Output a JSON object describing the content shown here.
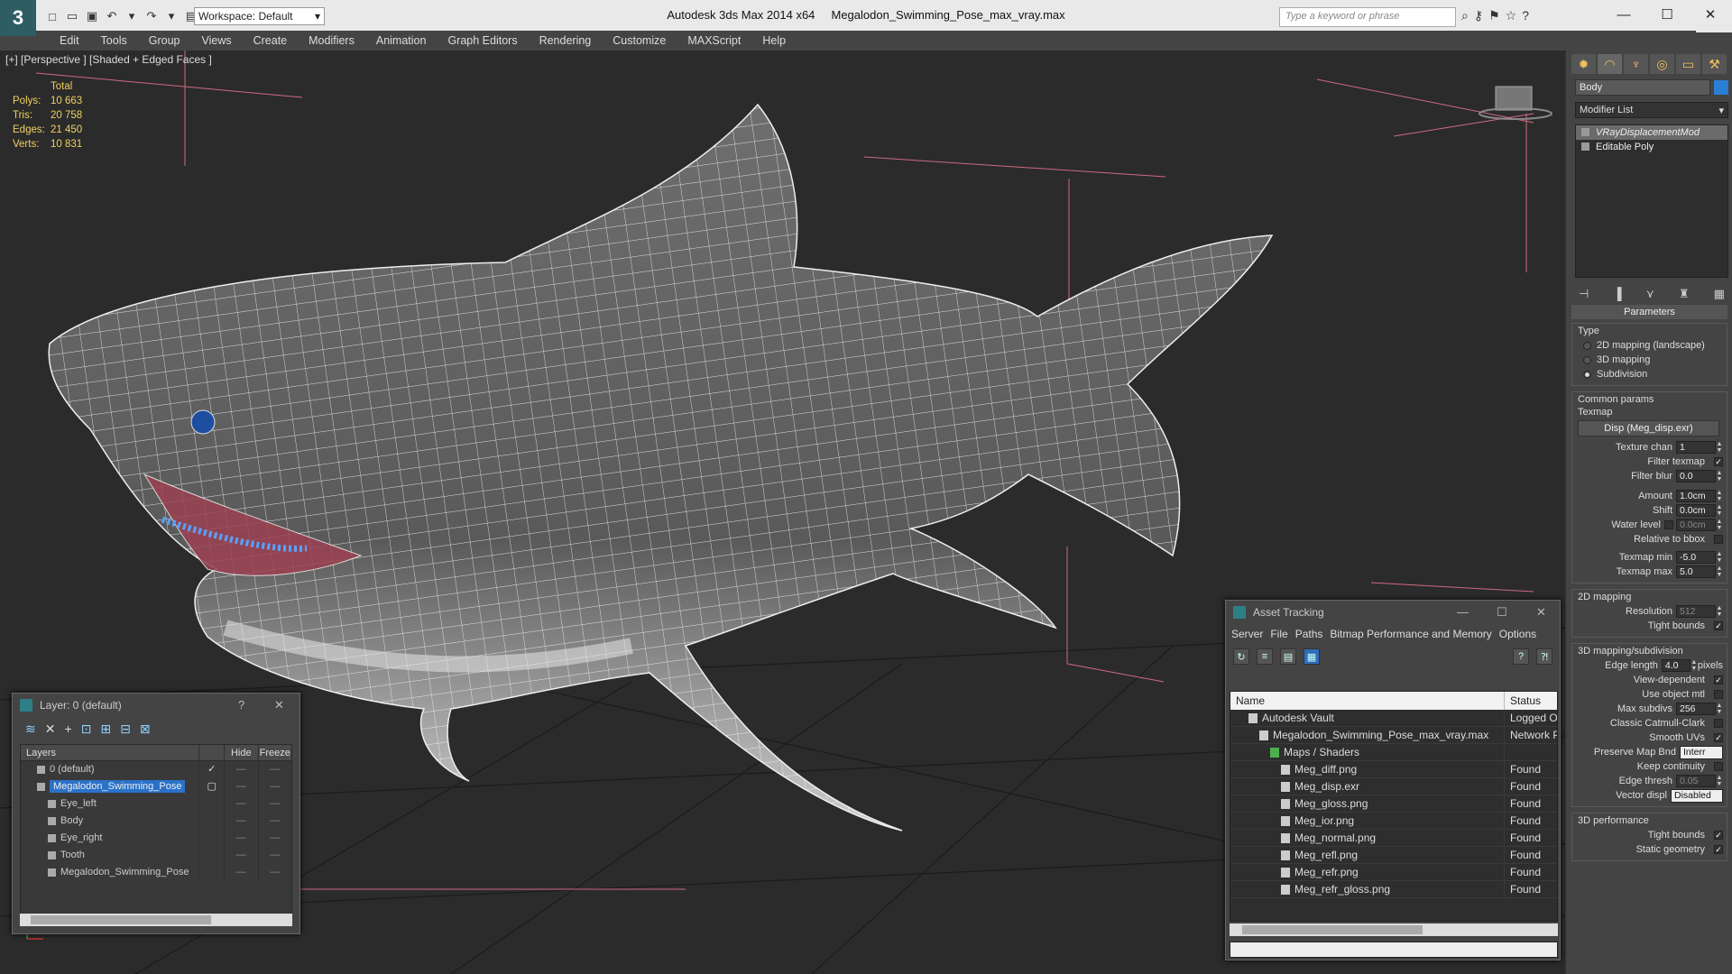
{
  "title_bar": {
    "logo": "3",
    "workspace_label": "Workspace: Default",
    "app_name": "Autodesk 3ds Max  2014 x64",
    "file_name": "Megalodon_Swimming_Pose_max_vray.max",
    "search_placeholder": "Type a keyword or phrase",
    "help_symbol": "?",
    "minimize": "—",
    "maximize": "☐",
    "close": "✕"
  },
  "menu": [
    "Edit",
    "Tools",
    "Group",
    "Views",
    "Create",
    "Modifiers",
    "Animation",
    "Graph Editors",
    "Rendering",
    "Customize",
    "MAXScript",
    "Help"
  ],
  "viewport": {
    "label": "[+] [Perspective ] [Shaded + Edged Faces ]",
    "stats_header": "Total",
    "stats": [
      {
        "label": "Polys:",
        "value": "10 663"
      },
      {
        "label": "Tris:",
        "value": "20 758"
      },
      {
        "label": "Edges:",
        "value": "21 450"
      },
      {
        "label": "Verts:",
        "value": "10 831"
      }
    ]
  },
  "command_panel": {
    "object_name": "Body",
    "object_color": "#2a7fd4",
    "modifier_list": "Modifier List",
    "stack": [
      {
        "label": "VRayDisplacementMod",
        "selected": true
      },
      {
        "label": "Editable Poly",
        "selected": false
      }
    ],
    "rollout_title": "Parameters",
    "type_group": "Type",
    "type_options": [
      {
        "label": "2D mapping (landscape)",
        "on": false
      },
      {
        "label": "3D mapping",
        "on": false
      },
      {
        "label": "Subdivision",
        "on": true
      }
    ],
    "common_group": "Common params",
    "texmap_label": "Texmap",
    "texmap_button": "Disp (Meg_disp.exr)",
    "texture_chan": {
      "label": "Texture chan",
      "value": "1"
    },
    "filter_texmap": {
      "label": "Filter texmap",
      "checked": true
    },
    "filter_blur": {
      "label": "Filter blur",
      "value": "0.0"
    },
    "amount": {
      "label": "Amount",
      "value": "1.0cm"
    },
    "shift": {
      "label": "Shift",
      "value": "0.0cm"
    },
    "water_level": {
      "label": "Water level",
      "value": "0.0cm"
    },
    "relative_to_bbox": {
      "label": "Relative to bbox",
      "checked": false
    },
    "texmap_min": {
      "label": "Texmap min",
      "value": "-5.0"
    },
    "texmap_max": {
      "label": "Texmap max",
      "value": "5.0"
    },
    "mapping2d_group": "2D mapping",
    "resolution": {
      "label": "Resolution",
      "value": "512"
    },
    "tight_bounds_2d": {
      "label": "Tight bounds",
      "checked": true
    },
    "mapping3d_group": "3D mapping/subdivision",
    "edge_length": {
      "label": "Edge length",
      "value": "4.0",
      "unit": "pixels"
    },
    "view_dependent": {
      "label": "View-dependent",
      "checked": true
    },
    "use_object_mtl": {
      "label": "Use object mtl",
      "checked": false
    },
    "max_subdivs": {
      "label": "Max subdivs",
      "value": "256"
    },
    "classic_catmull": {
      "label": "Classic Catmull-Clark",
      "checked": false
    },
    "smooth_uvs": {
      "label": "Smooth UVs",
      "checked": true
    },
    "preserve_map_bnd": {
      "label": "Preserve Map Bnd",
      "value": "Interr"
    },
    "keep_continuity": {
      "label": "Keep continuity",
      "checked": false
    },
    "edge_thresh": {
      "label": "Edge thresh",
      "value": "0.05"
    },
    "vector_displ": {
      "label": "Vector displ",
      "value": "Disabled"
    },
    "perf_group": "3D performance",
    "tight_bounds_3d": {
      "label": "Tight bounds",
      "checked": true
    },
    "static_geometry": {
      "label": "Static geometry",
      "checked": true
    }
  },
  "layer_explorer": {
    "title": "Layer: 0 (default)",
    "help": "?",
    "close": "✕",
    "columns": [
      "Layers",
      "Hide",
      "Freeze"
    ],
    "rows": [
      {
        "name": "0 (default)",
        "indent": 1,
        "selected": false
      },
      {
        "name": "Megalodon_Swimming_Pose",
        "indent": 1,
        "selected": true
      },
      {
        "name": "Eye_left",
        "indent": 2,
        "selected": false
      },
      {
        "name": "Body",
        "indent": 2,
        "selected": false
      },
      {
        "name": "Eye_right",
        "indent": 2,
        "selected": false
      },
      {
        "name": "Tooth",
        "indent": 2,
        "selected": false
      },
      {
        "name": "Megalodon_Swimming_Pose",
        "indent": 2,
        "selected": false
      }
    ]
  },
  "asset_tracking": {
    "title": "Asset Tracking",
    "menu": [
      "Server",
      "File",
      "Paths",
      "Bitmap Performance and Memory",
      "Options"
    ],
    "columns": [
      "Name",
      "Status"
    ],
    "rows": [
      {
        "name": "Autodesk Vault",
        "status": "Logged Out",
        "indent": 1
      },
      {
        "name": "Megalodon_Swimming_Pose_max_vray.max",
        "status": "Network Path",
        "indent": 2
      },
      {
        "name": "Maps / Shaders",
        "status": "",
        "indent": 3
      },
      {
        "name": "Meg_diff.png",
        "status": "Found",
        "indent": 4
      },
      {
        "name": "Meg_disp.exr",
        "status": "Found",
        "indent": 4
      },
      {
        "name": "Meg_gloss.png",
        "status": "Found",
        "indent": 4
      },
      {
        "name": "Meg_ior.png",
        "status": "Found",
        "indent": 4
      },
      {
        "name": "Meg_normal.png",
        "status": "Found",
        "indent": 4
      },
      {
        "name": "Meg_refl.png",
        "status": "Found",
        "indent": 4
      },
      {
        "name": "Meg_refr.png",
        "status": "Found",
        "indent": 4
      },
      {
        "name": "Meg_refr_gloss.png",
        "status": "Found",
        "indent": 4
      }
    ]
  }
}
